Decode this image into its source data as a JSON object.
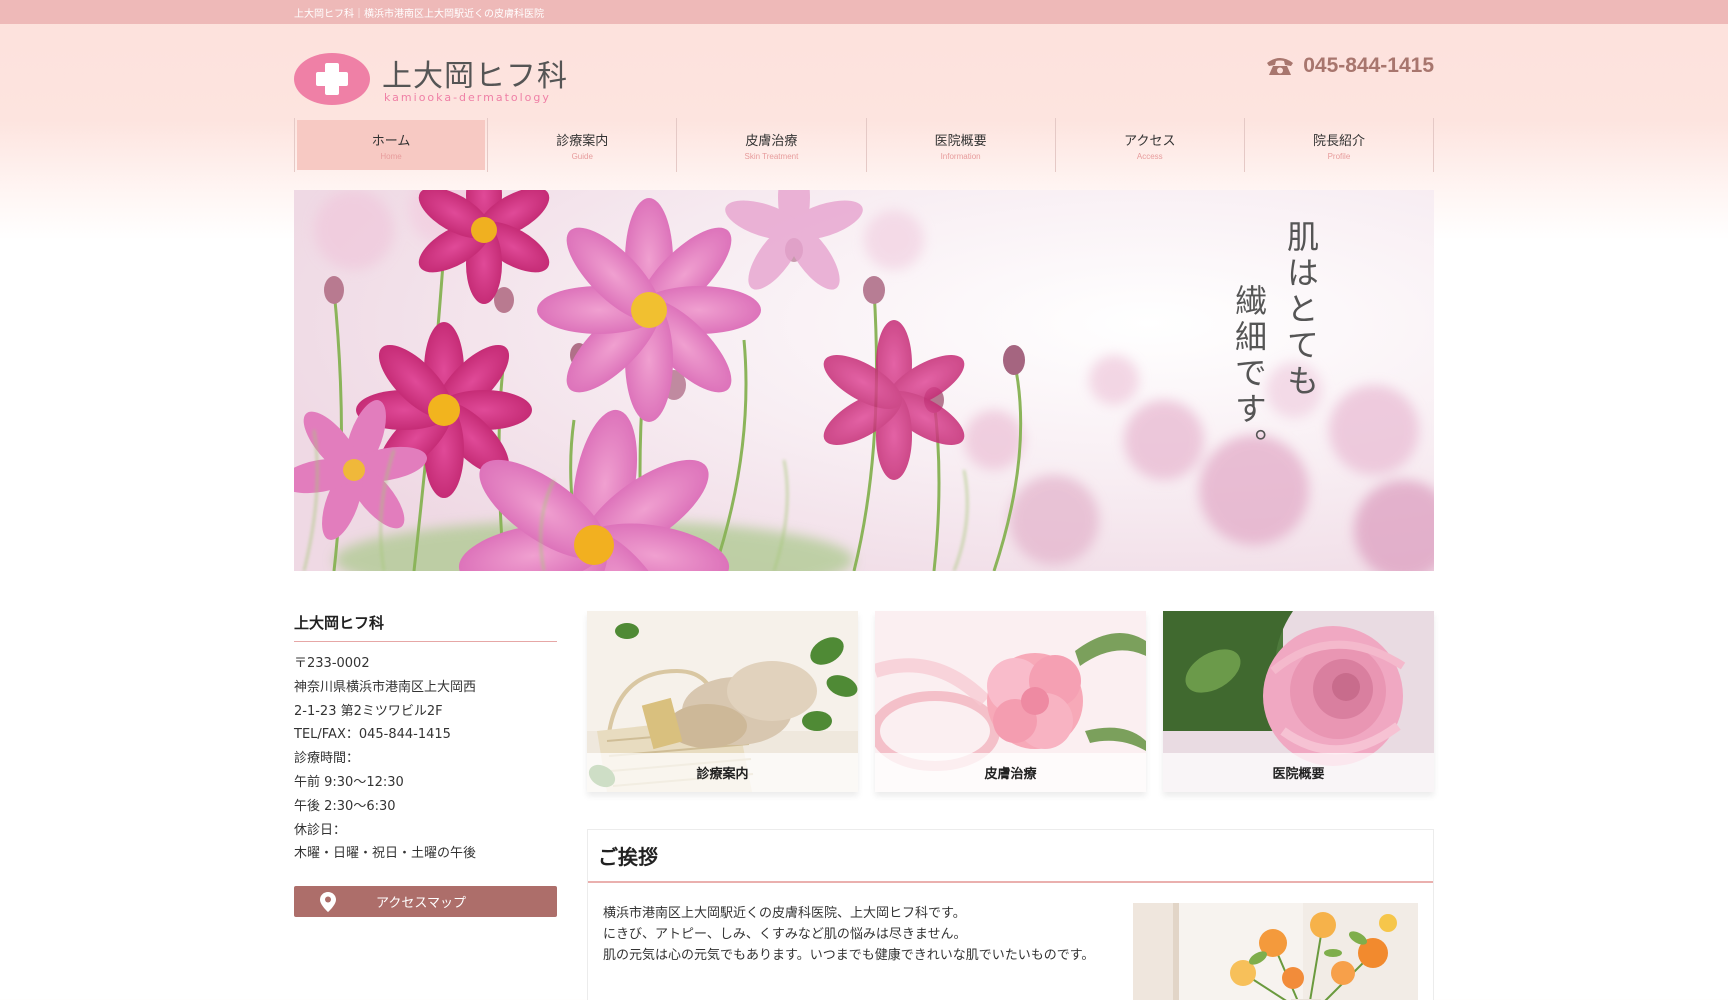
{
  "topbar": {
    "text": "上大岡ヒフ科｜横浜市港南区上大岡駅近くの皮膚科医院"
  },
  "header": {
    "logo_jp": "上大岡ヒフ科",
    "logo_en": "kamiooka-dermatology",
    "tel": "045-844-1415",
    "tel_icon": "phone-icon",
    "brand_color": "#ef80a6",
    "tel_color": "#a8766e"
  },
  "nav": {
    "items": [
      {
        "jp": "ホーム",
        "en": "Home",
        "active": true
      },
      {
        "jp": "診療案内",
        "en": "Guide"
      },
      {
        "jp": "皮膚治療",
        "en": "Skin Treatment"
      },
      {
        "jp": "医院概要",
        "en": "Information"
      },
      {
        "jp": "アクセス",
        "en": "Access"
      },
      {
        "jp": "院長紹介",
        "en": "Profile"
      }
    ]
  },
  "hero": {
    "copy_col1": "肌はとても",
    "copy_col2": "繊細です。"
  },
  "sidebar": {
    "title": "上大岡ヒフ科",
    "lines": [
      "〒233-0002",
      "神奈川県横浜市港南区上大岡西",
      "2-1-23 第2ミツワビル2F",
      "TEL/FAX：045-844-1415",
      "診療時間：",
      "午前 9:30～12:30",
      "午後 2:30～6:30",
      "休診日：",
      "木曜・日曜・祝日・土曜の午後"
    ],
    "access_button": "アクセスマップ",
    "access_button_color": "#ad6e6a"
  },
  "cards": [
    {
      "label": "診療案内"
    },
    {
      "label": "皮膚治療"
    },
    {
      "label": "医院概要"
    }
  ],
  "greeting": {
    "title": "ご挨拶",
    "lines": [
      "横浜市港南区上大岡駅近くの皮膚科医院、上大岡ヒフ科です。",
      "にきび、アトピー、しみ、くすみなど肌の悩みは尽きません。",
      "肌の元気は心の元気でもあります。いつまでも健康できれいな肌でいたいものです。"
    ]
  }
}
